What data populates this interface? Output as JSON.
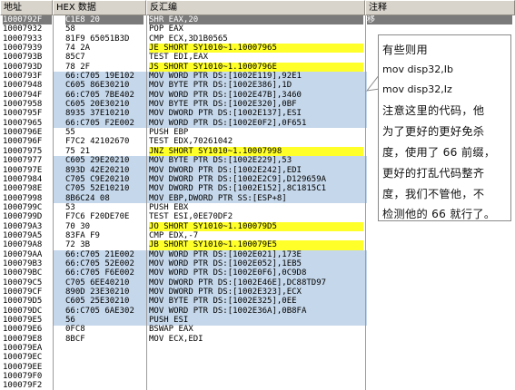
{
  "headers": {
    "address": "地址",
    "hex": "HEX 数据",
    "disasm": "反汇编",
    "comment": "注释"
  },
  "rows": [
    {
      "addr": "1000792F",
      "hex": "C1E8 20",
      "dis": "SHR EAX,20",
      "cm": "移",
      "sel": true
    },
    {
      "addr": "10007932",
      "hex": "58",
      "dis": "POP EAX",
      "cm": ""
    },
    {
      "addr": "10007933",
      "hex": "81F9 65051B3D",
      "dis": "CMP ECX,3D1B0565",
      "cm": ""
    },
    {
      "addr": "10007939",
      "hex": "74 2A",
      "dis": "JE SHORT SY1010~1.10007965",
      "cm": ""
    },
    {
      "addr": "1000793B",
      "hex": "85C7",
      "dis": "TEST EDI,EAX",
      "cm": ""
    },
    {
      "addr": "1000793D",
      "hex": "78 2F",
      "dis": "JS SHORT SY1010~1.1000796E",
      "cm": ""
    },
    {
      "addr": "1000793F",
      "hex": "66:C705 19E102",
      "dis": "MOV WORD PTR DS:[1002E119],92E1",
      "cm": ""
    },
    {
      "addr": "10007948",
      "hex": "C605 86E30210",
      "dis": "MOV BYTE PTR DS:[1002E386],1D",
      "cm": ""
    },
    {
      "addr": "1000794F",
      "hex": "66:C705 7BE402",
      "dis": "MOV WORD PTR DS:[1002E47B],3460",
      "cm": ""
    },
    {
      "addr": "10007958",
      "hex": "C605 20E30210",
      "dis": "MOV BYTE PTR DS:[1002E320],0BF",
      "cm": ""
    },
    {
      "addr": "1000795F",
      "hex": "8935 37E10210",
      "dis": "MOV DWORD PTR DS:[1002E137],ESI",
      "cm": ""
    },
    {
      "addr": "10007965",
      "hex": "66:C705 F2E002",
      "dis": "MOV WORD PTR DS:[1002E0F2],0F651",
      "cm": ""
    },
    {
      "addr": "1000796E",
      "hex": "55",
      "dis": "PUSH EBP",
      "cm": ""
    },
    {
      "addr": "1000796F",
      "hex": "F7C2 42102670",
      "dis": "TEST EDX,70261042",
      "cm": ""
    },
    {
      "addr": "10007975",
      "hex": "75 21",
      "dis": "JNZ SHORT SY1010~1.10007998",
      "cm": ""
    },
    {
      "addr": "10007977",
      "hex": "C605 29E20210",
      "dis": "MOV BYTE PTR DS:[1002E229],53",
      "cm": ""
    },
    {
      "addr": "1000797E",
      "hex": "893D 42E20210",
      "dis": "MOV DWORD PTR DS:[1002E242],EDI",
      "cm": ""
    },
    {
      "addr": "10007984",
      "hex": "C705 C9E20210",
      "dis": "MOV DWORD PTR DS:[1002E2C9],D129659A",
      "cm": ""
    },
    {
      "addr": "1000798E",
      "hex": "C705 52E10210",
      "dis": "MOV DWORD PTR DS:[1002E152],8C1815C1",
      "cm": ""
    },
    {
      "addr": "10007998",
      "hex": "8B6C24 08",
      "dis": "MOV EBP,DWORD PTR SS:[ESP+8]",
      "cm": ""
    },
    {
      "addr": "1000799C",
      "hex": "53",
      "dis": "PUSH EBX",
      "cm": ""
    },
    {
      "addr": "1000799D",
      "hex": "F7C6 F20DE70E",
      "dis": "TEST ESI,0EE70DF2",
      "cm": ""
    },
    {
      "addr": "100079A3",
      "hex": "70 30",
      "dis": "JO SHORT SY1010~1.100079D5",
      "cm": ""
    },
    {
      "addr": "100079A5",
      "hex": "83FA F9",
      "dis": "CMP EDX,-7",
      "cm": ""
    },
    {
      "addr": "100079A8",
      "hex": "72 3B",
      "dis": "JB SHORT SY1010~1.100079E5",
      "cm": ""
    },
    {
      "addr": "100079AA",
      "hex": "66:C705 21E002",
      "dis": "MOV WORD PTR DS:[1002E021],173E",
      "cm": ""
    },
    {
      "addr": "100079B3",
      "hex": "66:C705 52E002",
      "dis": "MOV WORD PTR DS:[1002E052],1EB5",
      "cm": ""
    },
    {
      "addr": "100079BC",
      "hex": "66:C705 F6E002",
      "dis": "MOV WORD PTR DS:[1002E0F6],0C9D8",
      "cm": ""
    },
    {
      "addr": "100079C5",
      "hex": "C705 6EE40210",
      "dis": "MOV DWORD PTR DS:[1002E46E],DC88TD97",
      "cm": ""
    },
    {
      "addr": "100079CF",
      "hex": "890D 23E30210",
      "dis": "MOV DWORD PTR DS:[1002E323],ECX",
      "cm": ""
    },
    {
      "addr": "100079D5",
      "hex": "C605 25E30210",
      "dis": "MOV BYTE PTR DS:[1002E325],0EE",
      "cm": ""
    },
    {
      "addr": "100079DC",
      "hex": "66:C705 6AE302",
      "dis": "MOV WORD PTR DS:[1002E36A],0B8FA",
      "cm": ""
    },
    {
      "addr": "100079E5",
      "hex": "56",
      "dis": "PUSH ESI",
      "cm": ""
    },
    {
      "addr": "100079E6",
      "hex": "0FC8",
      "dis": "BSWAP EAX",
      "cm": ""
    },
    {
      "addr": "100079E8",
      "hex": "8BCF",
      "dis": "MOV ECX,EDI",
      "cm": ""
    },
    {
      "addr": "100079EA",
      "hex": "",
      "dis": "",
      "cm": ""
    },
    {
      "addr": "100079EC",
      "hex": "",
      "dis": "",
      "cm": ""
    },
    {
      "addr": "100079EE",
      "hex": "",
      "dis": "",
      "cm": ""
    },
    {
      "addr": "100079F0",
      "hex": "",
      "dis": "",
      "cm": ""
    },
    {
      "addr": "100079F2",
      "hex": "",
      "dis": "",
      "cm": ""
    }
  ],
  "callout": {
    "line1": "有些则用",
    "line2": "mov disp32,Ib",
    "line3": "mov disp32,Iz",
    "line4": "注意这里的代码，他",
    "line5": "为了更好的更好免杀",
    "line6": "度，使用了 66 前缀，",
    "line7": "更好的打乱代码整齐",
    "line8": "度，我们不管他，不",
    "line9": "检测他的 66 就行了。"
  },
  "colors": {
    "highlight": "#c5d7ea",
    "jump_highlight": "#ffff2a",
    "selected_row": "#7a7a7a"
  }
}
